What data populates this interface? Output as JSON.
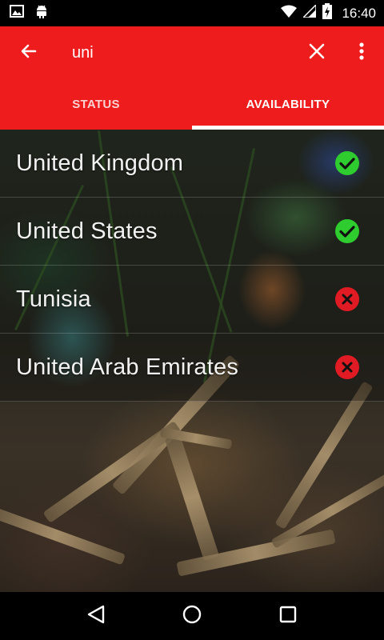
{
  "status_bar": {
    "time": "16:40",
    "icons": [
      "image-icon",
      "android-icon",
      "wifi-icon",
      "signal-icon",
      "battery-charging-icon"
    ]
  },
  "toolbar": {
    "search_value": "uni",
    "back_icon": "arrow-back-icon",
    "clear_icon": "close-icon",
    "more_icon": "more-vert-icon"
  },
  "tabs": [
    {
      "label": "STATUS",
      "active": false
    },
    {
      "label": "AVAILABILITY",
      "active": true
    }
  ],
  "colors": {
    "accent": "#ee1c1c",
    "available": "#2ecc2e",
    "unavailable": "#e01b24"
  },
  "results": [
    {
      "name": "United Kingdom",
      "available": true,
      "icon": "check-circle-icon"
    },
    {
      "name": "United States",
      "available": true,
      "icon": "check-circle-icon"
    },
    {
      "name": "Tunisia",
      "available": false,
      "icon": "cancel-circle-icon"
    },
    {
      "name": "United Arab Emirates",
      "available": false,
      "icon": "cancel-circle-icon"
    }
  ],
  "nav_bar": {
    "icons": [
      "back-triangle-icon",
      "home-circle-icon",
      "recents-square-icon"
    ]
  }
}
